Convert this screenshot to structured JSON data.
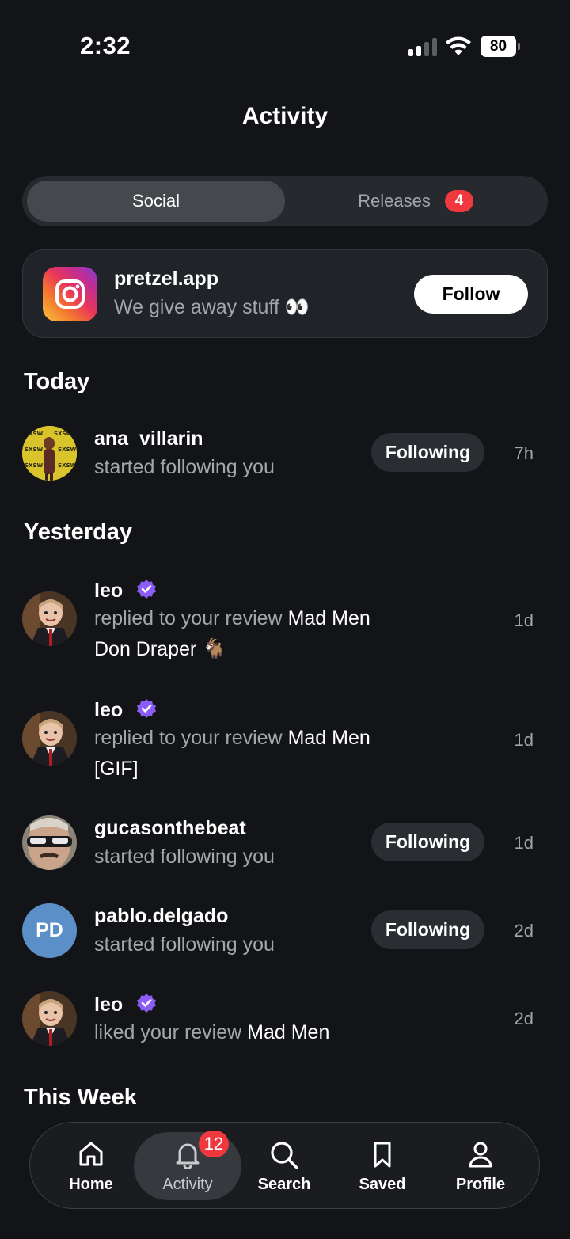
{
  "status": {
    "time": "2:32",
    "battery": "80"
  },
  "header": {
    "title": "Activity"
  },
  "tabs": {
    "social": "Social",
    "releases": "Releases",
    "releases_badge": "4"
  },
  "promo": {
    "name": "pretzel.app",
    "subtitle": "We give away stuff 👀",
    "follow_label": "Follow"
  },
  "sections": {
    "today": "Today",
    "yesterday": "Yesterday",
    "this_week": "This Week"
  },
  "items": [
    {
      "user": "ana_villarin",
      "action": "started following you",
      "button": "Following",
      "time": "7h"
    },
    {
      "user": "leo",
      "action": "replied to your review",
      "target": "Mad Men",
      "comment": "Don Draper 🐐",
      "time": "1d"
    },
    {
      "user": "leo",
      "action": "replied to your review",
      "target": "Mad Men",
      "comment": "[GIF]",
      "time": "1d"
    },
    {
      "user": "gucasonthebeat",
      "action": "started following you",
      "button": "Following",
      "time": "1d"
    },
    {
      "user": "pablo.delgado",
      "initials": "PD",
      "action": "started following you",
      "button": "Following",
      "time": "2d"
    },
    {
      "user": "leo",
      "action": "liked your review",
      "target": "Mad Men",
      "time": "2d"
    }
  ],
  "nav": {
    "home": "Home",
    "activity": "Activity",
    "activity_badge": "12",
    "search": "Search",
    "saved": "Saved",
    "profile": "Profile"
  },
  "colors": {
    "background": "#121417",
    "badge": "#f0383f",
    "verified": "#8b5cf6",
    "pd_avatar": "#5b8fc7"
  }
}
